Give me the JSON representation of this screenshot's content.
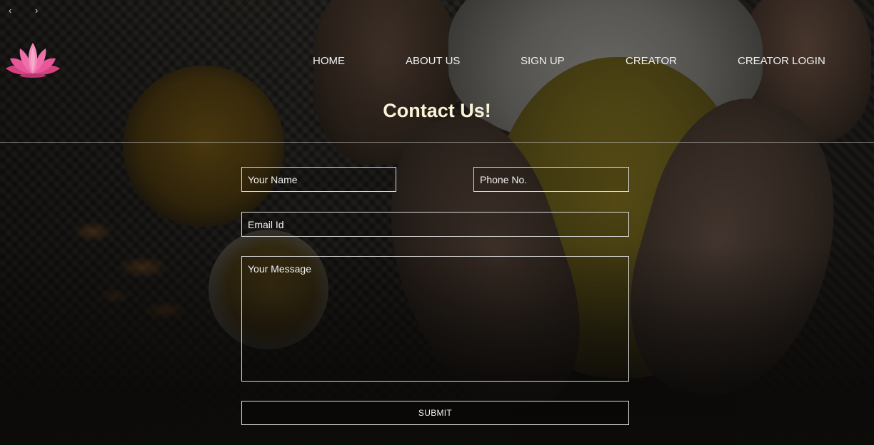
{
  "browser": {
    "back_glyph": "‹",
    "forward_glyph": "›"
  },
  "logo": {
    "icon": "lotus-icon",
    "petal_color": "#e8579a",
    "petal_light_color": "#f7a8cc"
  },
  "nav": {
    "items": [
      {
        "label": "HOME"
      },
      {
        "label": "ABOUT US"
      },
      {
        "label": "SIGN UP"
      },
      {
        "label": "CREATOR"
      },
      {
        "label": "CREATOR LOGIN"
      }
    ]
  },
  "page_title": "Contact Us!",
  "form": {
    "name_placeholder": "Your Name",
    "phone_placeholder": "Phone No.",
    "email_placeholder": "Email Id",
    "message_placeholder": "Your Message",
    "submit_label": "SUBMIT"
  },
  "colors": {
    "title": "#fbf3d8",
    "text": "#f2f2f2",
    "border": "#d9d9d9"
  }
}
